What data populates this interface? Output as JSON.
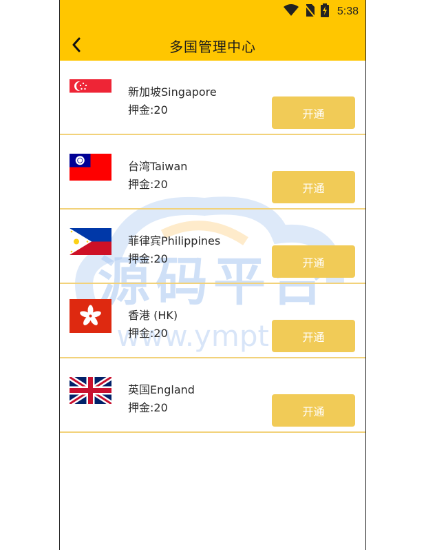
{
  "status_bar": {
    "time": "5:38",
    "icons": [
      "wifi-icon",
      "no-sim-icon",
      "battery-charging-icon"
    ]
  },
  "header": {
    "title": "多国管理中心",
    "back_icon": "chevron-left-icon",
    "background": "#FFC600"
  },
  "countries": [
    {
      "name": "新加坡Singapore",
      "deposit": "押金:20",
      "action": "开通",
      "flag": "singapore"
    },
    {
      "name": "台湾Taiwan",
      "deposit": "押金:20",
      "action": "开通",
      "flag": "taiwan"
    },
    {
      "name": "菲律宾Philippines",
      "deposit": "押金:20",
      "action": "开通",
      "flag": "philippines"
    },
    {
      "name": "香港 (HK)",
      "deposit": "押金:20",
      "action": "开通",
      "flag": "hongkong"
    },
    {
      "name": "英国England",
      "deposit": "押金:20",
      "action": "开通",
      "flag": "uk"
    }
  ],
  "watermark": {
    "text_cn": "源码平台",
    "text_url": "www.ympt.cc"
  },
  "colors": {
    "accent": "#FFC600",
    "button": "#F1CB57",
    "divider": "#F2D27A"
  }
}
